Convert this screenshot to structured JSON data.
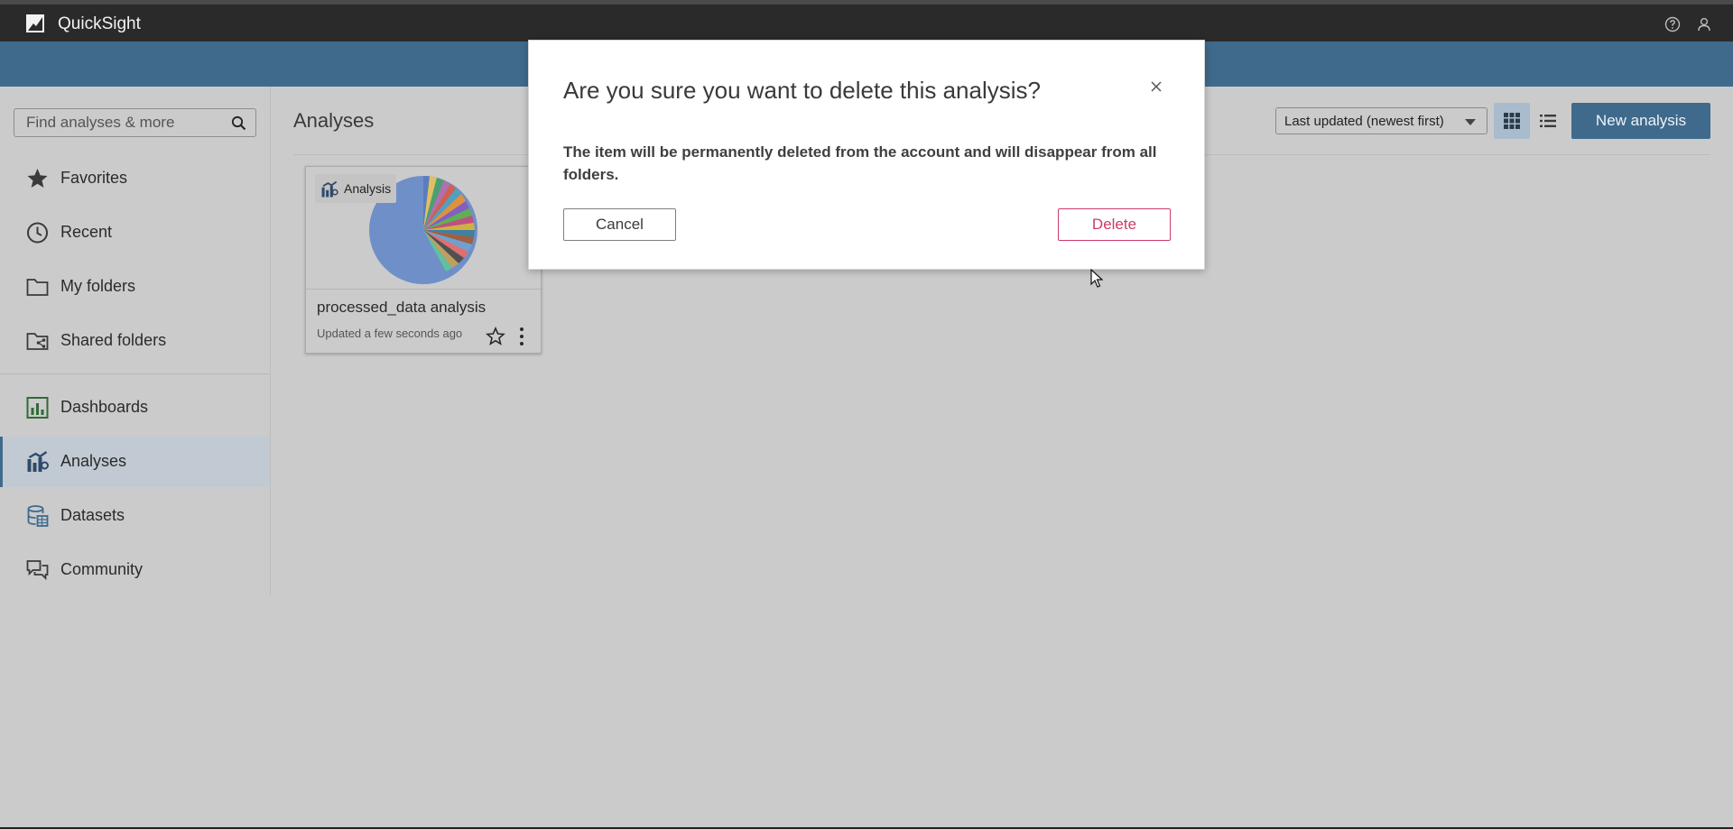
{
  "app": {
    "name": "QuickSight"
  },
  "search": {
    "placeholder": "Find analyses & more"
  },
  "sidebar": {
    "items": [
      {
        "label": "Favorites"
      },
      {
        "label": "Recent"
      },
      {
        "label": "My folders"
      },
      {
        "label": "Shared folders"
      },
      {
        "label": "Dashboards"
      },
      {
        "label": "Analyses",
        "active": true
      },
      {
        "label": "Datasets"
      },
      {
        "label": "Community"
      }
    ]
  },
  "main": {
    "title": "Analyses",
    "sort": {
      "selected": "Last updated (newest first)"
    },
    "view_mode": "grid",
    "new_button_label": "New analysis",
    "cards": [
      {
        "badge": "Analysis",
        "name": "processed_data analysis",
        "updated": "Updated a few seconds ago"
      }
    ]
  },
  "modal": {
    "title": "Are you sure you want to delete this analysis?",
    "body": "The item will be permanently deleted from the account and will disappear from all folders.",
    "cancel_label": "Cancel",
    "delete_label": "Delete"
  },
  "colors": {
    "topbar": "#2a2a2a",
    "accent": "#3f6a8c",
    "delete": "#cc3b66",
    "overlay_background": "#cbcbcb"
  },
  "icons": {
    "logo": "quicksight-logo-icon",
    "help": "help-icon",
    "user": "user-icon",
    "search": "search-icon",
    "grid_view": "grid-view-icon",
    "list_view": "list-view-icon",
    "close": "close-icon",
    "favorite": "star-icon",
    "more": "more-vertical-icon"
  }
}
